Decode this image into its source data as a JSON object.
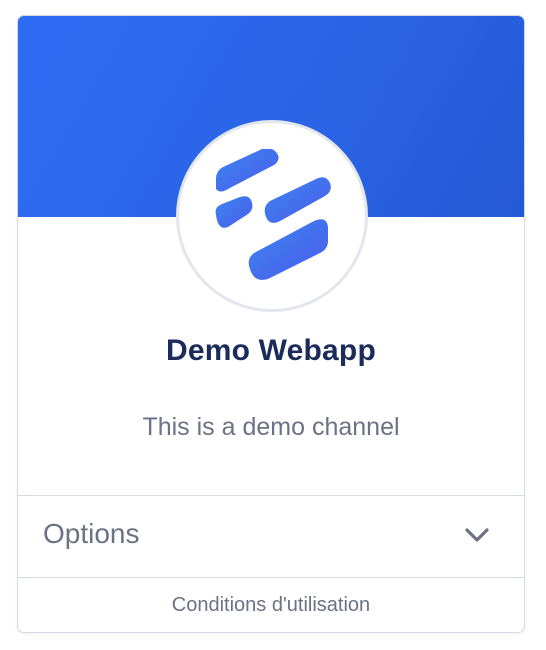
{
  "channel": {
    "name": "Demo Webapp",
    "description": "This is a demo channel",
    "logo_icon": "stacked-bars-hexagon-logo-icon"
  },
  "options": {
    "label": "Options",
    "expand_icon": "chevron-down-icon"
  },
  "footer": {
    "terms_link": "Conditions d'utilisation"
  },
  "colors": {
    "banner": "#2a64e6",
    "title": "#1b2c5a",
    "muted_text": "#6a7283",
    "border": "#d6dae3",
    "logo_gradient_start": "#3d86ef",
    "logo_gradient_end": "#4a5bec"
  }
}
